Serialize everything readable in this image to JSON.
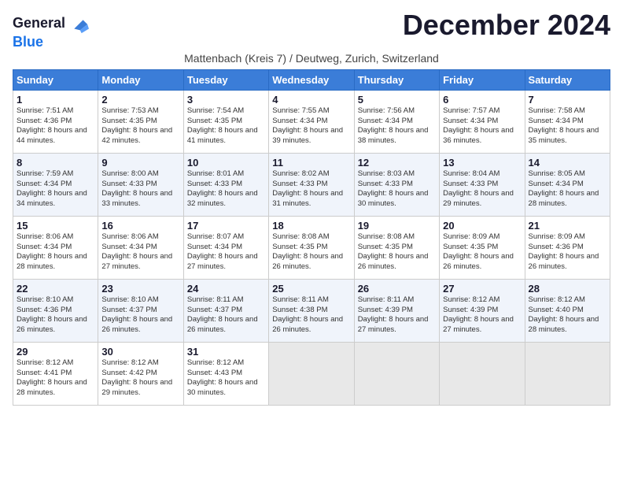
{
  "logo": {
    "line1": "General",
    "line2": "Blue"
  },
  "title": "December 2024",
  "subtitle": "Mattenbach (Kreis 7) / Deutweg, Zurich, Switzerland",
  "days_of_week": [
    "Sunday",
    "Monday",
    "Tuesday",
    "Wednesday",
    "Thursday",
    "Friday",
    "Saturday"
  ],
  "weeks": [
    [
      {
        "day": "1",
        "sunrise": "7:51 AM",
        "sunset": "4:36 PM",
        "daylight": "8 hours and 44 minutes."
      },
      {
        "day": "2",
        "sunrise": "7:53 AM",
        "sunset": "4:35 PM",
        "daylight": "8 hours and 42 minutes."
      },
      {
        "day": "3",
        "sunrise": "7:54 AM",
        "sunset": "4:35 PM",
        "daylight": "8 hours and 41 minutes."
      },
      {
        "day": "4",
        "sunrise": "7:55 AM",
        "sunset": "4:34 PM",
        "daylight": "8 hours and 39 minutes."
      },
      {
        "day": "5",
        "sunrise": "7:56 AM",
        "sunset": "4:34 PM",
        "daylight": "8 hours and 38 minutes."
      },
      {
        "day": "6",
        "sunrise": "7:57 AM",
        "sunset": "4:34 PM",
        "daylight": "8 hours and 36 minutes."
      },
      {
        "day": "7",
        "sunrise": "7:58 AM",
        "sunset": "4:34 PM",
        "daylight": "8 hours and 35 minutes."
      }
    ],
    [
      {
        "day": "8",
        "sunrise": "7:59 AM",
        "sunset": "4:34 PM",
        "daylight": "8 hours and 34 minutes."
      },
      {
        "day": "9",
        "sunrise": "8:00 AM",
        "sunset": "4:33 PM",
        "daylight": "8 hours and 33 minutes."
      },
      {
        "day": "10",
        "sunrise": "8:01 AM",
        "sunset": "4:33 PM",
        "daylight": "8 hours and 32 minutes."
      },
      {
        "day": "11",
        "sunrise": "8:02 AM",
        "sunset": "4:33 PM",
        "daylight": "8 hours and 31 minutes."
      },
      {
        "day": "12",
        "sunrise": "8:03 AM",
        "sunset": "4:33 PM",
        "daylight": "8 hours and 30 minutes."
      },
      {
        "day": "13",
        "sunrise": "8:04 AM",
        "sunset": "4:33 PM",
        "daylight": "8 hours and 29 minutes."
      },
      {
        "day": "14",
        "sunrise": "8:05 AM",
        "sunset": "4:34 PM",
        "daylight": "8 hours and 28 minutes."
      }
    ],
    [
      {
        "day": "15",
        "sunrise": "8:06 AM",
        "sunset": "4:34 PM",
        "daylight": "8 hours and 28 minutes."
      },
      {
        "day": "16",
        "sunrise": "8:06 AM",
        "sunset": "4:34 PM",
        "daylight": "8 hours and 27 minutes."
      },
      {
        "day": "17",
        "sunrise": "8:07 AM",
        "sunset": "4:34 PM",
        "daylight": "8 hours and 27 minutes."
      },
      {
        "day": "18",
        "sunrise": "8:08 AM",
        "sunset": "4:35 PM",
        "daylight": "8 hours and 26 minutes."
      },
      {
        "day": "19",
        "sunrise": "8:08 AM",
        "sunset": "4:35 PM",
        "daylight": "8 hours and 26 minutes."
      },
      {
        "day": "20",
        "sunrise": "8:09 AM",
        "sunset": "4:35 PM",
        "daylight": "8 hours and 26 minutes."
      },
      {
        "day": "21",
        "sunrise": "8:09 AM",
        "sunset": "4:36 PM",
        "daylight": "8 hours and 26 minutes."
      }
    ],
    [
      {
        "day": "22",
        "sunrise": "8:10 AM",
        "sunset": "4:36 PM",
        "daylight": "8 hours and 26 minutes."
      },
      {
        "day": "23",
        "sunrise": "8:10 AM",
        "sunset": "4:37 PM",
        "daylight": "8 hours and 26 minutes."
      },
      {
        "day": "24",
        "sunrise": "8:11 AM",
        "sunset": "4:37 PM",
        "daylight": "8 hours and 26 minutes."
      },
      {
        "day": "25",
        "sunrise": "8:11 AM",
        "sunset": "4:38 PM",
        "daylight": "8 hours and 26 minutes."
      },
      {
        "day": "26",
        "sunrise": "8:11 AM",
        "sunset": "4:39 PM",
        "daylight": "8 hours and 27 minutes."
      },
      {
        "day": "27",
        "sunrise": "8:12 AM",
        "sunset": "4:39 PM",
        "daylight": "8 hours and 27 minutes."
      },
      {
        "day": "28",
        "sunrise": "8:12 AM",
        "sunset": "4:40 PM",
        "daylight": "8 hours and 28 minutes."
      }
    ],
    [
      {
        "day": "29",
        "sunrise": "8:12 AM",
        "sunset": "4:41 PM",
        "daylight": "8 hours and 28 minutes."
      },
      {
        "day": "30",
        "sunrise": "8:12 AM",
        "sunset": "4:42 PM",
        "daylight": "8 hours and 29 minutes."
      },
      {
        "day": "31",
        "sunrise": "8:12 AM",
        "sunset": "4:43 PM",
        "daylight": "8 hours and 30 minutes."
      },
      null,
      null,
      null,
      null
    ]
  ]
}
